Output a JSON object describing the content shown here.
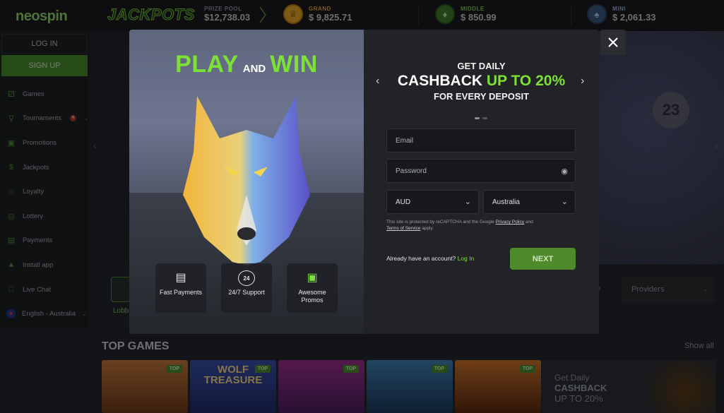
{
  "brand": {
    "logo": "neospin",
    "accent": "#7de036"
  },
  "topbar": {
    "jackpots_word": "JACKPOTS",
    "prize_pool": {
      "label": "PRIZE POOL",
      "value": "$12,738.03"
    },
    "jackpots": [
      {
        "label": "GRAND",
        "value": "$ 9,825.71",
        "color": "#e3a72a",
        "icon": "lion-medal-icon"
      },
      {
        "label": "MIDDLE",
        "value": "$ 850.99",
        "color": "#7ac943",
        "icon": "wolf-medal-icon"
      },
      {
        "label": "MINI",
        "value": "$ 2,061.33",
        "color": "#8fb4e0",
        "icon": "panther-medal-icon"
      }
    ]
  },
  "sidebar": {
    "login": "LOG IN",
    "signup": "SIGN UP",
    "items": [
      {
        "label": "Games",
        "icon": "dice-icon"
      },
      {
        "label": "Tournaments",
        "icon": "trophy-icon",
        "badge": "4"
      },
      {
        "label": "Promotions",
        "icon": "gift-icon"
      },
      {
        "label": "Jackpots",
        "icon": "moneybag-icon"
      },
      {
        "label": "Loyalty",
        "icon": "star-icon"
      },
      {
        "label": "Lottery",
        "icon": "lottery-icon"
      },
      {
        "label": "Payments",
        "icon": "payments-icon"
      },
      {
        "label": "Install app",
        "icon": "android-icon"
      },
      {
        "label": "Live Chat",
        "icon": "chat-icon"
      },
      {
        "label": "English - Australia",
        "icon": "flag-au-icon"
      }
    ]
  },
  "background": {
    "lobby": "Lobb",
    "providers": "Providers",
    "top_games": "TOP GAMES",
    "show_all": "Show all",
    "games": [
      {
        "name": "",
        "badge": "TOP"
      },
      {
        "name": "WOLF TREASURE",
        "badge": "TOP"
      },
      {
        "name": "",
        "badge": "TOP"
      },
      {
        "name": "",
        "badge": "TOP"
      },
      {
        "name": "",
        "badge": "TOP"
      }
    ],
    "promo": {
      "line1": "Get Daily",
      "line2": "CASHBACK",
      "line3": "UP TO 20%"
    }
  },
  "modal": {
    "headline": {
      "play": "PLAY",
      "and": "AND",
      "win": "WIN"
    },
    "features": [
      {
        "label": "Fast Payments",
        "icon": "wallet-icon"
      },
      {
        "label": "24/7 Support",
        "icon": "support-24-icon"
      },
      {
        "label": "Awesome Promos",
        "icon": "gift-icon"
      }
    ],
    "promo": {
      "line1": "GET DAILY",
      "line2_white": "CASHBACK ",
      "line2_green": "UP TO 20%",
      "line3": "FOR EVERY DEPOSIT"
    },
    "form": {
      "email_placeholder": "Email",
      "password_placeholder": "Password",
      "currency": "AUD",
      "country": "Australia",
      "recaptcha_pre": "This site is protected by reCAPTCHA and the Google ",
      "privacy": "Privacy Policy",
      "and": " and ",
      "terms": "Terms of Service",
      "applies": " apply.",
      "already": "Already have an account? ",
      "login_link": "Log In",
      "next": "NEXT"
    }
  }
}
